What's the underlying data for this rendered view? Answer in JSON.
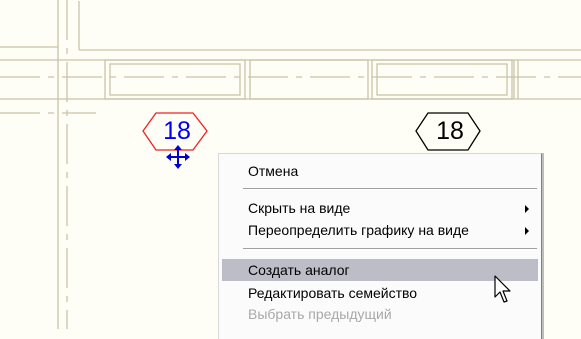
{
  "drawing": {
    "tags": [
      {
        "label": "18",
        "state": "selected",
        "color": "#0000ee",
        "outline": "#ee2222"
      },
      {
        "label": "18",
        "state": "normal",
        "color": "#000000",
        "outline": "#000000"
      }
    ],
    "line_color": "#c9c3a8",
    "background": "#fffef6"
  },
  "context_menu": {
    "items": [
      {
        "label": "Отмена"
      },
      {
        "label": "Скрыть на виде",
        "submenu": true
      },
      {
        "label": "Переопределить графику на виде",
        "submenu": true
      },
      {
        "label": "Создать аналог",
        "highlighted": true
      },
      {
        "label": "Редактировать семейство"
      },
      {
        "label": "Выбрать предыдущий",
        "disabled": true
      }
    ],
    "highlight_color": "#bdbdc7"
  },
  "icons": [
    "move-icon",
    "arrow-cursor-icon",
    "submenu-arrow-icon"
  ]
}
